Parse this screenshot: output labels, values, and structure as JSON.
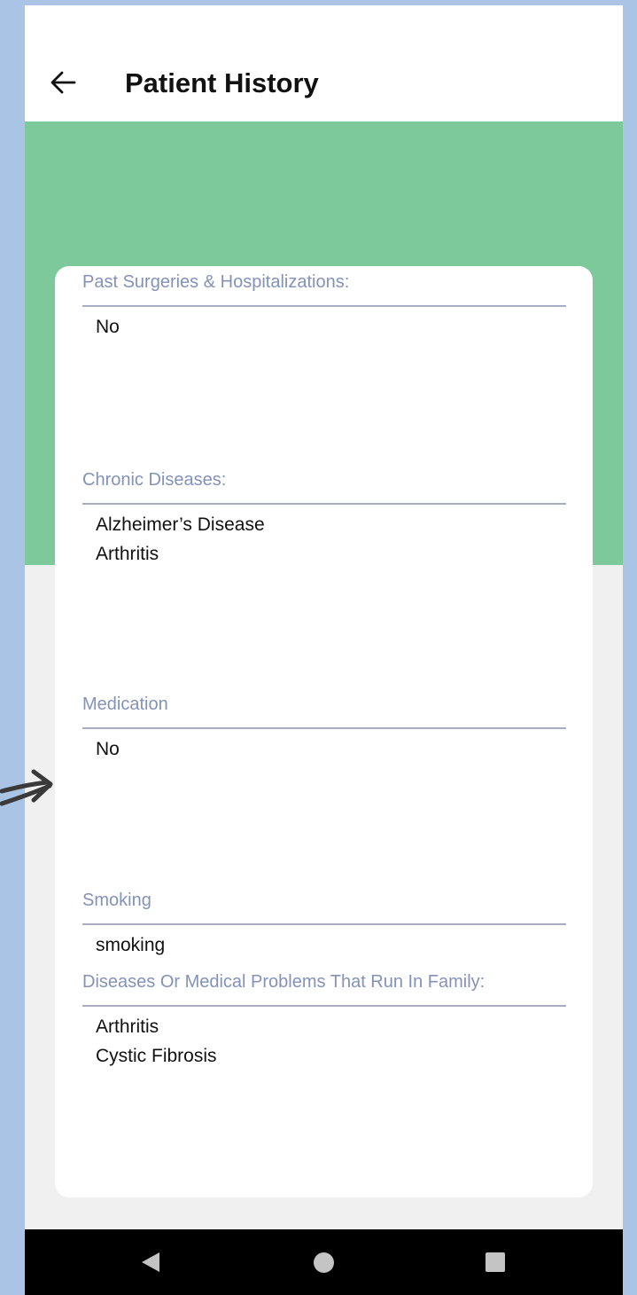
{
  "header": {
    "title": "Patient History",
    "back_icon": "arrow-left-icon"
  },
  "colors": {
    "banner": "#7dc99c",
    "label": "#8492b8",
    "background": "#a9c4e4"
  },
  "sections": [
    {
      "label": "Past Surgeries & Hospitalizations:",
      "values": [
        "No"
      ]
    },
    {
      "label": "Chronic Diseases:",
      "values": [
        "Alzheimer’s Disease",
        "Arthritis"
      ]
    },
    {
      "label": "Medication",
      "values": [
        "No"
      ]
    },
    {
      "label": "Smoking",
      "values": [
        "smoking"
      ]
    },
    {
      "label": "Diseases Or Medical Problems That Run In Family:",
      "values": [
        "Arthritis",
        "Cystic Fibrosis"
      ]
    }
  ],
  "nav": {
    "back_icon": "triangle-back-icon",
    "home_icon": "circle-home-icon",
    "recents_icon": "square-recents-icon"
  }
}
